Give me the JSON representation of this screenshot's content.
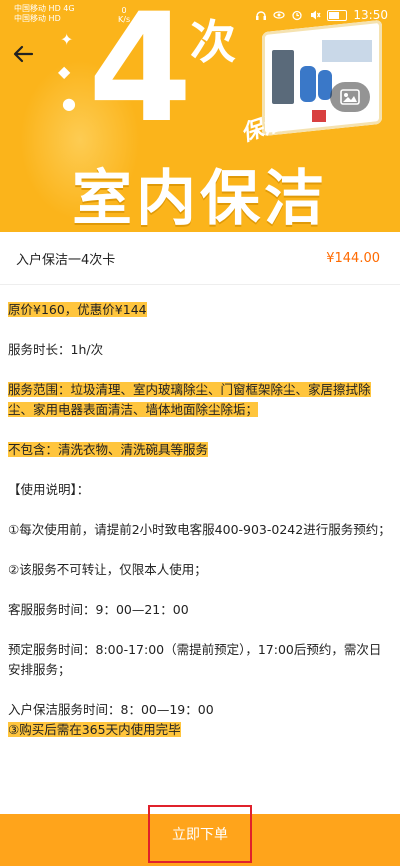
{
  "status_bar": {
    "carrier_1": "中国移动",
    "carrier_2": "中国移动",
    "badge_1": "HD",
    "badge_2": "HD",
    "net": "4G",
    "speed_value": "0",
    "speed_unit": "K/s",
    "battery_level": "52",
    "time": "13:50"
  },
  "banner": {
    "number": "4",
    "ci": "次",
    "tag": "保洁",
    "title": "室内保洁"
  },
  "product": {
    "name": "入户保洁一4次卡",
    "price": "¥144.00"
  },
  "description": {
    "price_line": "原价¥160，优惠价¥144",
    "duration": "服务时长：1h/次",
    "scope": "服务范围：垃圾清理、室内玻璃除尘、门窗框架除尘、家居擦拭除尘、家用电器表面清洁、墙体地面除尘除垢；",
    "excluded": "不包含：清洗衣物、清洗碗具等服务",
    "usage_title": "【使用说明】：",
    "item1": "①每次使用前，请提前2小时致电客服400-903-0242进行服务预约；",
    "item2": "②该服务不可转让，仅限本人使用；",
    "cs_time": "客服服务时间：9：00—21：00",
    "reserve_time": "预定服务时间：8:00-17:00（需提前预定），17:00后预约，需次日安排服务；",
    "home_time": "入户保洁服务时间：8：00—19：00",
    "item3": "③购买后需在365天内使用完毕"
  },
  "footer": {
    "order_button": "立即下单"
  }
}
